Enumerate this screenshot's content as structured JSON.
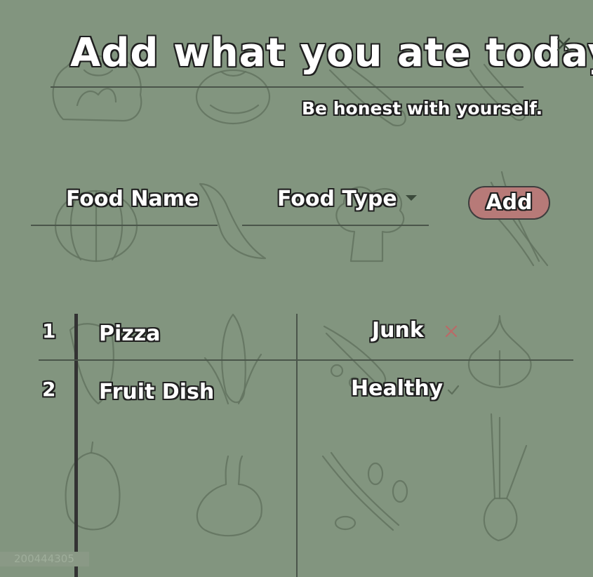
{
  "header": {
    "title": "Add what you ate today",
    "subtitle": "Be honest with yourself.",
    "close_icon": "close-icon"
  },
  "form": {
    "food_name_label": "Food Name",
    "food_type_label": "Food Type",
    "add_label": "Add"
  },
  "entries": [
    {
      "number": "1",
      "name": "Pizza",
      "type": "Junk",
      "status_icon": "x-mark-icon"
    },
    {
      "number": "2",
      "name": "Fruit Dish",
      "type": "Healthy",
      "status_icon": "check-icon"
    }
  ],
  "watermark": "200444305",
  "colors": {
    "background": "#82957f",
    "add_button": "#b77a78",
    "junk_mark": "#b96a67",
    "healthy_mark": "#5e6f5b"
  }
}
